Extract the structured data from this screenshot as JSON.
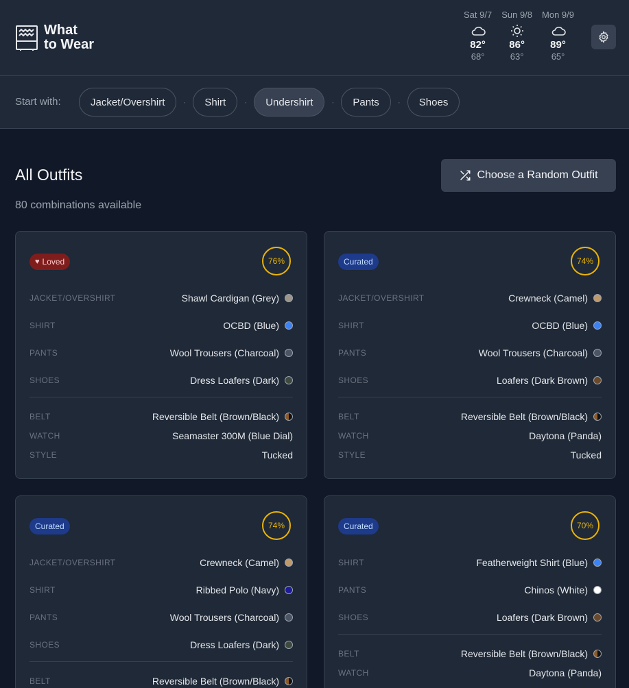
{
  "app": {
    "title_line1": "What",
    "title_line2": "to Wear"
  },
  "weather": [
    {
      "day": "Sat 9/7",
      "icon": "cloud-icon",
      "high": "82°",
      "low": "68°"
    },
    {
      "day": "Sun 9/8",
      "icon": "sun-icon",
      "high": "86°",
      "low": "63°"
    },
    {
      "day": "Mon 9/9",
      "icon": "cloud-icon",
      "high": "89°",
      "low": "65°"
    }
  ],
  "filter": {
    "label": "Start with:",
    "chips": [
      "Jacket/Overshirt",
      "Shirt",
      "Undershirt",
      "Pants",
      "Shoes"
    ],
    "separator": "·",
    "active": "Undershirt"
  },
  "section": {
    "title": "All Outfits",
    "subtitle": "80 combinations available",
    "random_label": "Choose a Random Outfit"
  },
  "colors": {
    "loved": "#7f1d1d",
    "curated": "#1e3a8a",
    "score_ring": "#eab308"
  },
  "cards": [
    {
      "badge": "Loved",
      "score": "76%",
      "main": [
        {
          "k": "JACKET/OVERSHIRT",
          "v": "Shawl Cardigan (Grey)",
          "color": "#9c9589"
        },
        {
          "k": "SHIRT",
          "v": "OCBD (Blue)",
          "color": "#3b82f6"
        },
        {
          "k": "PANTS",
          "v": "Wool Trousers (Charcoal)",
          "color": "#4b5563"
        },
        {
          "k": "SHOES",
          "v": "Dress Loafers (Dark)",
          "color": "#3f4a3f"
        }
      ],
      "extra": [
        {
          "k": "BELT",
          "v": "Reversible Belt (Brown/Black)",
          "color": "split"
        },
        {
          "k": "WATCH",
          "v": "Seamaster 300M (Blue Dial)",
          "color": ""
        },
        {
          "k": "STYLE",
          "v": "Tucked",
          "color": ""
        }
      ]
    },
    {
      "badge": "Curated",
      "score": "74%",
      "main": [
        {
          "k": "JACKET/OVERSHIRT",
          "v": "Crewneck (Camel)",
          "color": "#c19a6b"
        },
        {
          "k": "SHIRT",
          "v": "OCBD (Blue)",
          "color": "#3b82f6"
        },
        {
          "k": "PANTS",
          "v": "Wool Trousers (Charcoal)",
          "color": "#4b5563"
        },
        {
          "k": "SHOES",
          "v": "Loafers (Dark Brown)",
          "color": "#6b4a2b"
        }
      ],
      "extra": [
        {
          "k": "BELT",
          "v": "Reversible Belt (Brown/Black)",
          "color": "split"
        },
        {
          "k": "WATCH",
          "v": "Daytona (Panda)",
          "color": ""
        },
        {
          "k": "STYLE",
          "v": "Tucked",
          "color": ""
        }
      ]
    },
    {
      "badge": "Curated",
      "score": "74%",
      "main": [
        {
          "k": "JACKET/OVERSHIRT",
          "v": "Crewneck (Camel)",
          "color": "#c19a6b"
        },
        {
          "k": "SHIRT",
          "v": "Ribbed Polo (Navy)",
          "color": "#1e1b9a"
        },
        {
          "k": "PANTS",
          "v": "Wool Trousers (Charcoal)",
          "color": "#4b5563"
        },
        {
          "k": "SHOES",
          "v": "Dress Loafers (Dark)",
          "color": "#3f4a3f"
        }
      ],
      "extra": [
        {
          "k": "BELT",
          "v": "Reversible Belt (Brown/Black)",
          "color": "split"
        }
      ]
    },
    {
      "badge": "Curated",
      "score": "70%",
      "main": [
        {
          "k": "SHIRT",
          "v": "Featherweight Shirt (Blue)",
          "color": "#3b82f6"
        },
        {
          "k": "PANTS",
          "v": "Chinos (White)",
          "color": "#ffffff"
        },
        {
          "k": "SHOES",
          "v": "Loafers (Dark Brown)",
          "color": "#6b4a2b"
        }
      ],
      "extra": [
        {
          "k": "BELT",
          "v": "Reversible Belt (Brown/Black)",
          "color": "split"
        },
        {
          "k": "WATCH",
          "v": "Daytona (Panda)",
          "color": ""
        }
      ]
    }
  ]
}
